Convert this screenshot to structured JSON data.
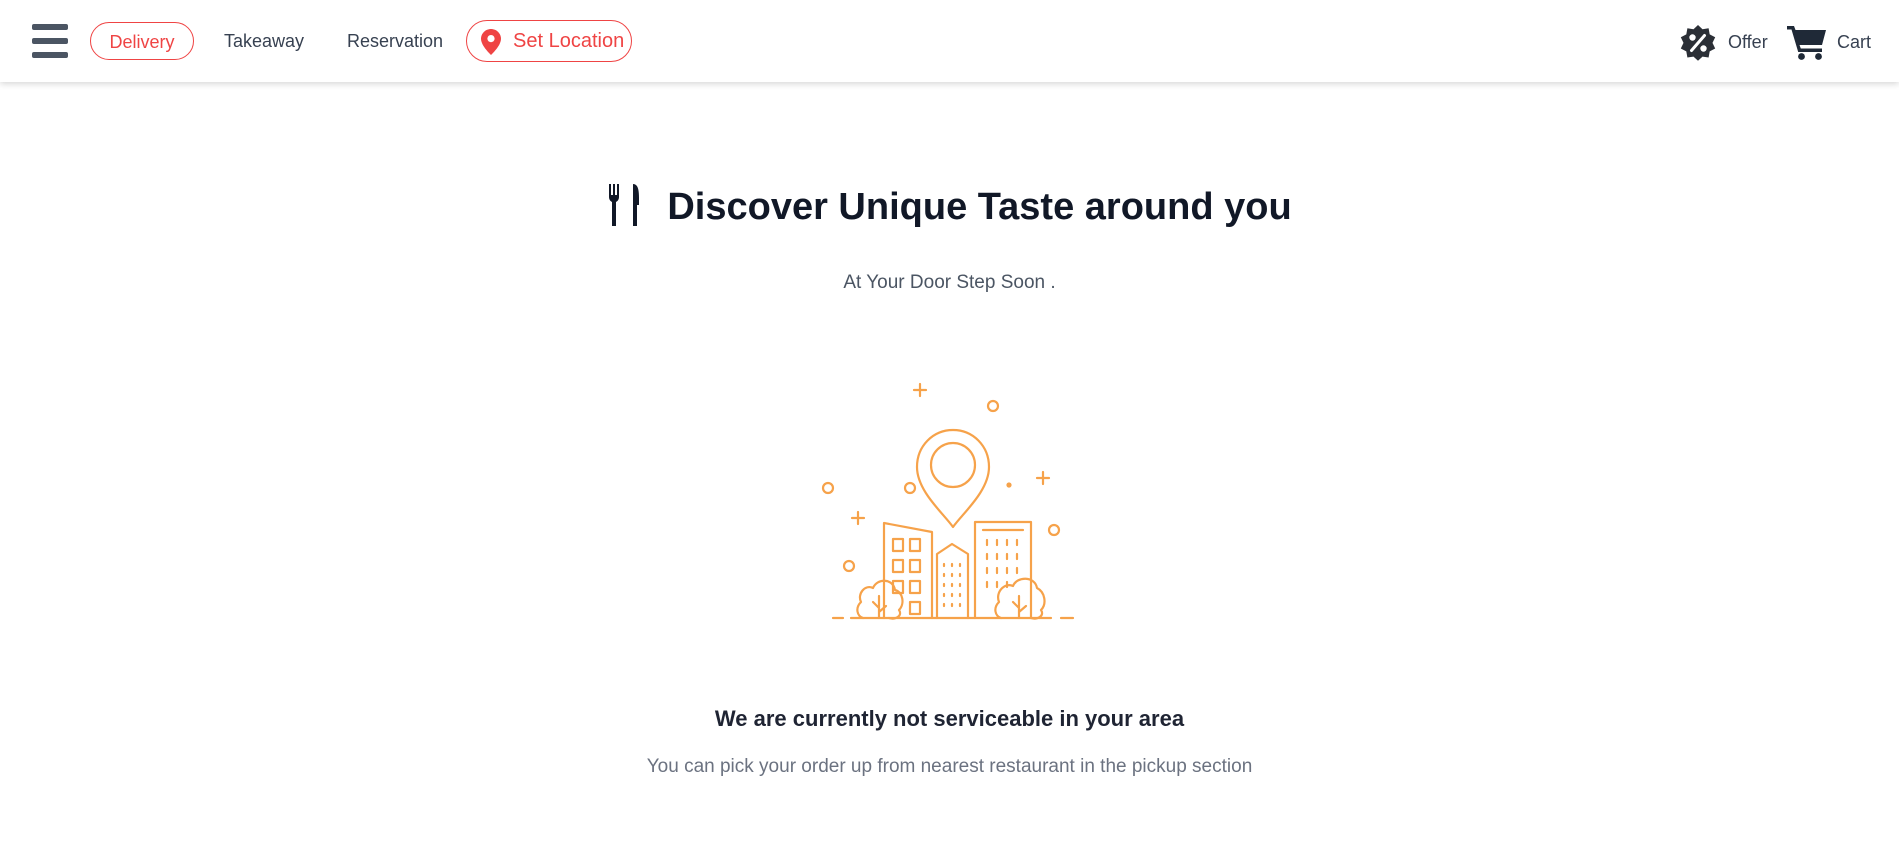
{
  "nav": {
    "delivery": "Delivery",
    "takeaway": "Takeaway",
    "reservation": "Reservation",
    "set_location": "Set Location",
    "offer": "Offer",
    "cart": "Cart"
  },
  "hero": {
    "title": "Discover Unique Taste around you",
    "subtitle": "At Your Door Step Soon ."
  },
  "message": {
    "title": "We are currently not serviceable in your area",
    "subtitle": "You can pick your order up from nearest restaurant in the pickup section"
  },
  "icons": {
    "menu": "hamburger-menu-icon",
    "location": "map-pin-icon",
    "offer": "percent-badge-icon",
    "cart": "shopping-cart-icon",
    "utensils": "fork-knife-icon",
    "illustration": "city-location-illustration"
  },
  "colors": {
    "accent": "#ef4444",
    "illustration": "#f6a24a",
    "text_dark": "#111827",
    "text_muted": "#6b7280"
  }
}
